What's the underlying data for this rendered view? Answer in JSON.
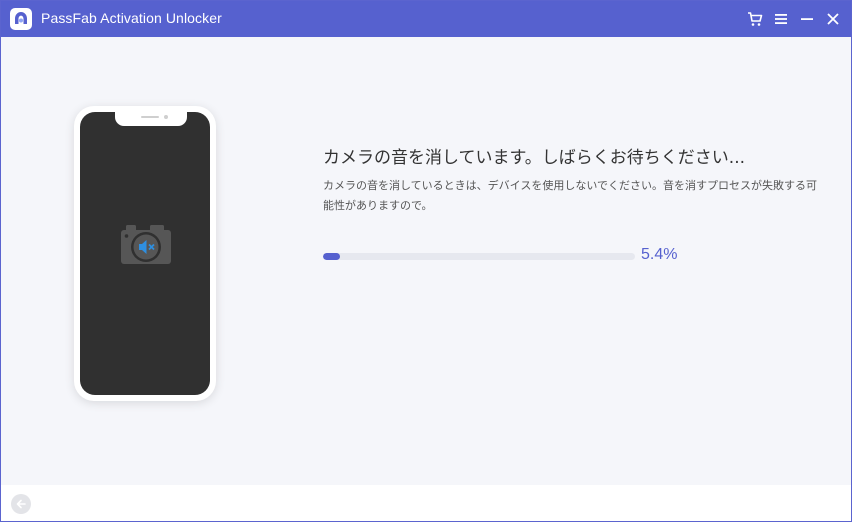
{
  "window": {
    "title": "PassFab Activation Unlocker",
    "accent_color": "#5661cf",
    "buttons": [
      "cart-icon",
      "menu-icon",
      "minimize-icon",
      "close-icon"
    ]
  },
  "main": {
    "heading": "カメラの音を消しています。しばらくお待ちください...",
    "description": "カメラの音を消しているときは、デバイスを使用しないでください。音を消すプロセスが失敗する可能性がありますので。",
    "progress": {
      "fraction": 0.054,
      "label": "5.4%"
    },
    "phone_screen_icon": "camera-mute-icon"
  },
  "footer": {
    "back_icon": "back-arrow-icon"
  }
}
